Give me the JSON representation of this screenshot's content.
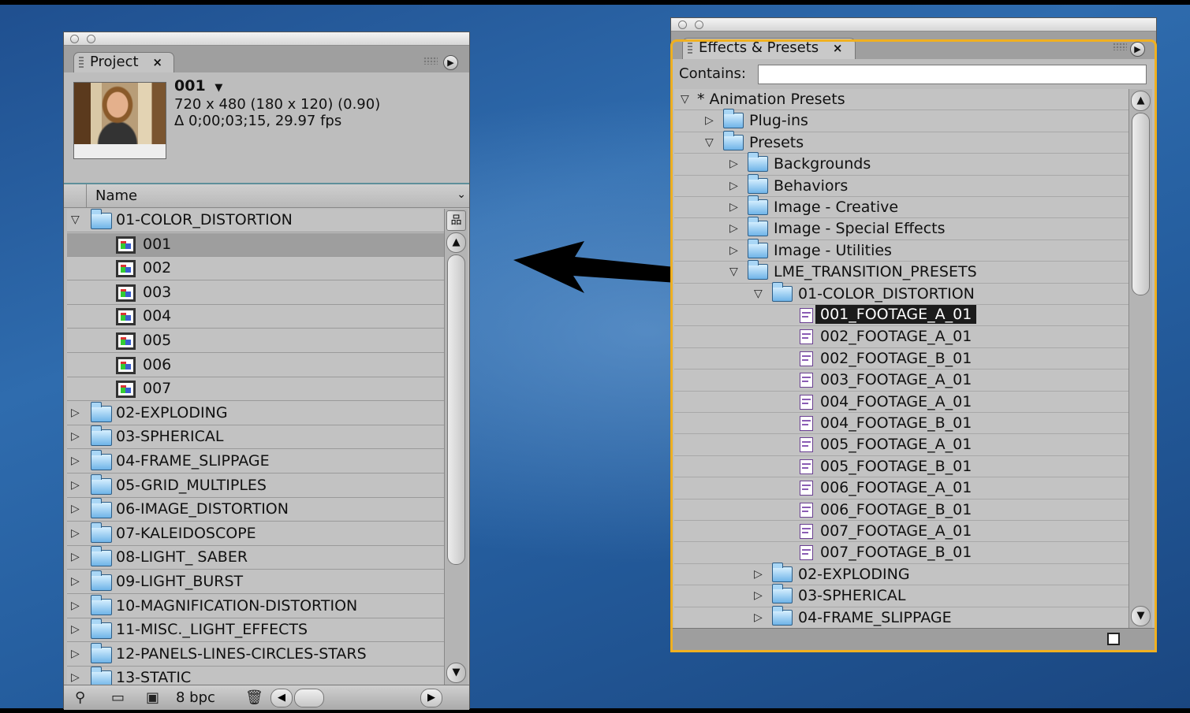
{
  "project_panel": {
    "tab_label": "Project",
    "close_glyph": "×",
    "footage": {
      "name": "001",
      "dims": "720 x 480  (180 x 120) (0.90)",
      "duration": "Δ 0;00;03;15, 29.97 fps"
    },
    "column_header": "Name",
    "rows": [
      {
        "label": "01-COLOR_DISTORTION",
        "kind": "folder",
        "expanded": true
      },
      {
        "label": "001",
        "kind": "comp",
        "selected": true
      },
      {
        "label": "002",
        "kind": "comp"
      },
      {
        "label": "003",
        "kind": "comp"
      },
      {
        "label": "004",
        "kind": "comp"
      },
      {
        "label": "005",
        "kind": "comp"
      },
      {
        "label": "006",
        "kind": "comp"
      },
      {
        "label": "007",
        "kind": "comp"
      },
      {
        "label": "02-EXPLODING",
        "kind": "folder"
      },
      {
        "label": "03-SPHERICAL",
        "kind": "folder"
      },
      {
        "label": "04-FRAME_SLIPPAGE",
        "kind": "folder"
      },
      {
        "label": "05-GRID_MULTIPLES",
        "kind": "folder"
      },
      {
        "label": "06-IMAGE_DISTORTION",
        "kind": "folder"
      },
      {
        "label": "07-KALEIDOSCOPE",
        "kind": "folder"
      },
      {
        "label": "08-LIGHT_ SABER",
        "kind": "folder"
      },
      {
        "label": "09-LIGHT_BURST",
        "kind": "folder"
      },
      {
        "label": "10-MAGNIFICATION-DISTORTION",
        "kind": "folder"
      },
      {
        "label": "11-MISC._LIGHT_EFFECTS",
        "kind": "folder"
      },
      {
        "label": "12-PANELS-LINES-CIRCLES-STARS",
        "kind": "folder"
      },
      {
        "label": "13-STATIC",
        "kind": "folder"
      }
    ],
    "footer": {
      "bpc_label": "8 bpc"
    }
  },
  "effects_panel": {
    "tab_label": "Effects & Presets",
    "close_glyph": "×",
    "contains_label": "Contains:",
    "contains_value": "",
    "rows": [
      {
        "label": "* Animation Presets",
        "kind": "root",
        "depth": 0,
        "expanded": true
      },
      {
        "label": "Plug-ins",
        "kind": "folder",
        "depth": 1
      },
      {
        "label": "Presets",
        "kind": "folder",
        "depth": 1,
        "expanded": true
      },
      {
        "label": "Backgrounds",
        "kind": "folder",
        "depth": 2
      },
      {
        "label": "Behaviors",
        "kind": "folder",
        "depth": 2
      },
      {
        "label": "Image - Creative",
        "kind": "folder",
        "depth": 2
      },
      {
        "label": "Image - Special Effects",
        "kind": "folder",
        "depth": 2
      },
      {
        "label": "Image - Utilities",
        "kind": "folder",
        "depth": 2
      },
      {
        "label": "LME_TRANSITION_PRESETS",
        "kind": "folder",
        "depth": 2,
        "expanded": true
      },
      {
        "label": "01-COLOR_DISTORTION",
        "kind": "folder",
        "depth": 3,
        "expanded": true
      },
      {
        "label": "001_FOOTAGE_A_01",
        "kind": "preset",
        "depth": 4,
        "selected": true
      },
      {
        "label": "002_FOOTAGE_A_01",
        "kind": "preset",
        "depth": 4
      },
      {
        "label": "002_FOOTAGE_B_01",
        "kind": "preset",
        "depth": 4
      },
      {
        "label": "003_FOOTAGE_A_01",
        "kind": "preset",
        "depth": 4
      },
      {
        "label": "004_FOOTAGE_A_01",
        "kind": "preset",
        "depth": 4
      },
      {
        "label": "004_FOOTAGE_B_01",
        "kind": "preset",
        "depth": 4
      },
      {
        "label": "005_FOOTAGE_A_01",
        "kind": "preset",
        "depth": 4
      },
      {
        "label": "005_FOOTAGE_B_01",
        "kind": "preset",
        "depth": 4
      },
      {
        "label": "006_FOOTAGE_A_01",
        "kind": "preset",
        "depth": 4
      },
      {
        "label": "006_FOOTAGE_B_01",
        "kind": "preset",
        "depth": 4
      },
      {
        "label": "007_FOOTAGE_A_01",
        "kind": "preset",
        "depth": 4
      },
      {
        "label": "007_FOOTAGE_B_01",
        "kind": "preset",
        "depth": 4
      },
      {
        "label": "02-EXPLODING",
        "kind": "folder",
        "depth": 3
      },
      {
        "label": "03-SPHERICAL",
        "kind": "folder",
        "depth": 3
      },
      {
        "label": "04-FRAME_SLIPPAGE",
        "kind": "folder",
        "depth": 3
      }
    ]
  },
  "colors": {
    "desktop": "#2f6cae",
    "panel_focus_outline": "#f0b020",
    "selection": "#1b1b1b"
  }
}
